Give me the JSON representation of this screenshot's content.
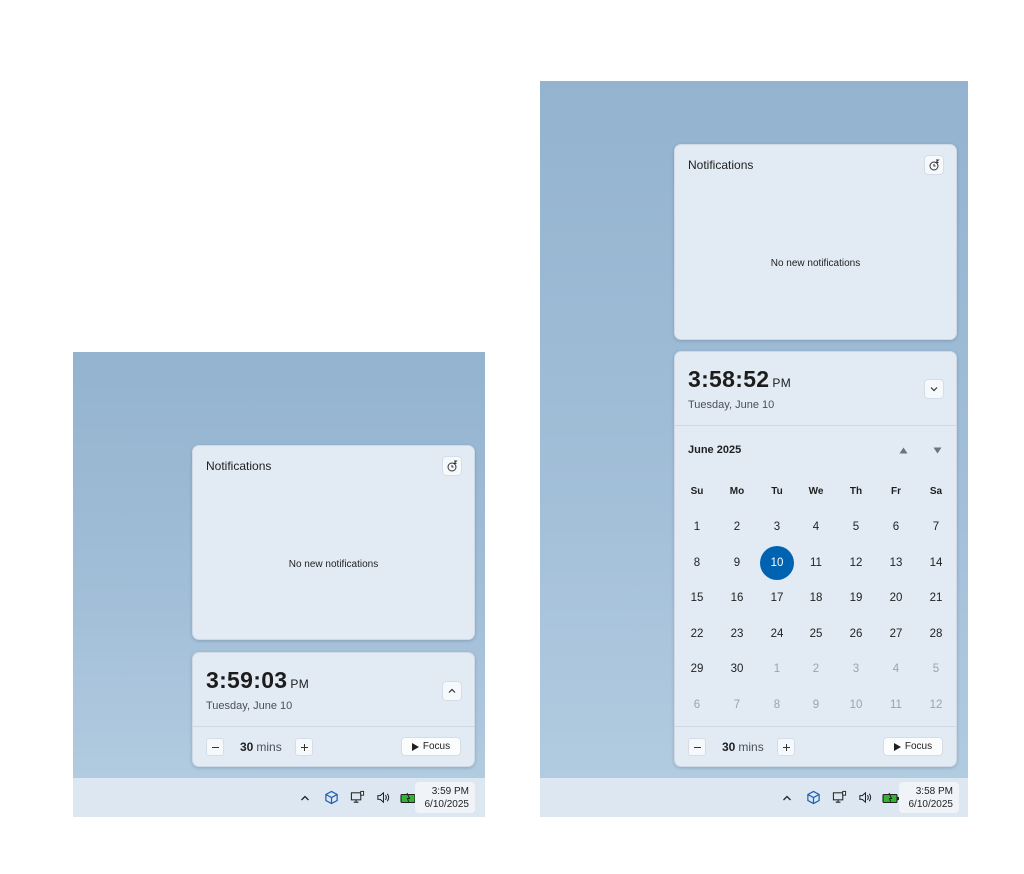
{
  "left": {
    "notifications": {
      "title": "Notifications",
      "empty": "No new notifications"
    },
    "clock": {
      "time": "3:59:03",
      "ampm": "PM",
      "date": "Tuesday, June 10"
    },
    "focus": {
      "minutes": "30",
      "unit": "mins",
      "button": "Focus"
    },
    "taskbar": {
      "time": "3:59 PM",
      "date": "6/10/2025"
    }
  },
  "right": {
    "notifications": {
      "title": "Notifications",
      "empty": "No new notifications"
    },
    "clock": {
      "time": "3:58:52",
      "ampm": "PM",
      "date": "Tuesday, June 10"
    },
    "calendar": {
      "month": "June 2025",
      "weekdays": [
        "Su",
        "Mo",
        "Tu",
        "We",
        "Th",
        "Fr",
        "Sa"
      ],
      "weeks": [
        [
          "1",
          "2",
          "3",
          "4",
          "5",
          "6",
          "7"
        ],
        [
          "8",
          "9",
          "10",
          "11",
          "12",
          "13",
          "14"
        ],
        [
          "15",
          "16",
          "17",
          "18",
          "19",
          "20",
          "21"
        ],
        [
          "22",
          "23",
          "24",
          "25",
          "26",
          "27",
          "28"
        ],
        [
          "29",
          "30",
          "1",
          "2",
          "3",
          "4",
          "5"
        ],
        [
          "6",
          "7",
          "8",
          "9",
          "10",
          "11",
          "12"
        ]
      ],
      "today": "10",
      "muted_from_index": 30
    },
    "focus": {
      "minutes": "30",
      "unit": "mins",
      "button": "Focus"
    },
    "taskbar": {
      "time": "3:58 PM",
      "date": "6/10/2025"
    }
  },
  "colors": {
    "accent": "#0063b1",
    "desktop": "#93b3cf",
    "taskbar": "#dce7f2"
  },
  "icons": [
    "chevron-up-icon",
    "vpn-cube-icon",
    "network-icon",
    "volume-icon",
    "battery-icon",
    "snooze-icon",
    "chevron-down-icon",
    "minus-icon",
    "plus-icon",
    "play-icon"
  ]
}
